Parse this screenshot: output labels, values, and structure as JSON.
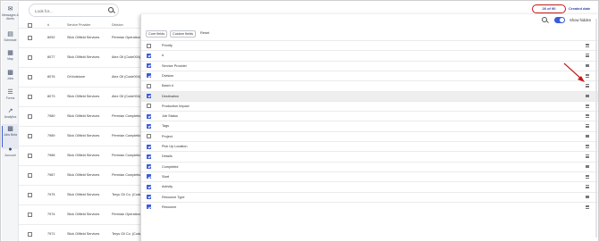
{
  "sidebar": {
    "items": [
      {
        "label": "Messages & Alerts",
        "icon": "chat-icon"
      },
      {
        "label": "Schedule",
        "icon": "calendar-icon"
      },
      {
        "label": "Map",
        "icon": "map-icon"
      },
      {
        "label": "Jobs",
        "icon": "jobs-icon"
      },
      {
        "label": "Forms",
        "icon": "forms-icon"
      },
      {
        "label": "Analytics",
        "icon": "analytics-icon"
      },
      {
        "label": "Jobs Beta",
        "icon": "jobs-beta-icon"
      },
      {
        "label": "Account",
        "icon": "account-icon"
      }
    ]
  },
  "search": {
    "placeholder": "Look for..."
  },
  "header": {
    "count_label": "26 of 90",
    "created_label": "Created date"
  },
  "table": {
    "columns": [
      "#",
      "Service Provider",
      "Division"
    ],
    "rows": [
      {
        "num": "8092",
        "provider": "Slick Oilfield Services",
        "division": "Permian Operations"
      },
      {
        "num": "8077",
        "provider": "Slick Oilfield Services",
        "division": "Alex Oil (Code004)"
      },
      {
        "num": "8076",
        "provider": "GrVodstone",
        "division": "Alex Oil (Code004)"
      },
      {
        "num": "8073",
        "provider": "Slick Oilfield Services",
        "division": "Alex Oil (Code004)"
      },
      {
        "num": "7980",
        "provider": "Slick Oilfield Services",
        "division": "Permian Completions"
      },
      {
        "num": "7989",
        "provider": "Slick Oilfield Services",
        "division": "Permian Completions"
      },
      {
        "num": "7988",
        "provider": "Slick Oilfield Services",
        "division": "Permian Completions"
      },
      {
        "num": "7987",
        "provider": "Slick Oilfield Services",
        "division": "Permian Completions"
      },
      {
        "num": "7975",
        "provider": "Slick Oilfield Services",
        "division": "Terys Oil Co. (Code001)"
      },
      {
        "num": "7974",
        "provider": "Slick Oilfield Services",
        "division": "Permian Operations"
      },
      {
        "num": "7972",
        "provider": "Slick Oilfield Services",
        "division": "Terys Oil Co. (Code001)"
      },
      {
        "num": "7971",
        "provider": "Slick Oilfield Services",
        "division": "Terys Oil Co. (Code001)"
      }
    ]
  },
  "panel": {
    "show_hidden_label": "Show hidden",
    "show_hidden_on": true,
    "tabs": [
      "Core fields",
      "Custom fields",
      "Reset"
    ],
    "fields": [
      {
        "label": "Priority",
        "checked": false
      },
      {
        "label": "#",
        "checked": true
      },
      {
        "label": "Service Provider",
        "checked": true
      },
      {
        "label": "Division",
        "checked": true
      },
      {
        "label": "Batch #",
        "checked": false
      },
      {
        "label": "Destination",
        "checked": true
      },
      {
        "label": "Production Impact",
        "checked": false
      },
      {
        "label": "Job Status",
        "checked": true
      },
      {
        "label": "Tags",
        "checked": true
      },
      {
        "label": "Project",
        "checked": false
      },
      {
        "label": "Pick Up Location",
        "checked": true
      },
      {
        "label": "Details",
        "checked": true
      },
      {
        "label": "Completed",
        "checked": true
      },
      {
        "label": "Start",
        "checked": true
      },
      {
        "label": "Activity",
        "checked": true
      },
      {
        "label": "Resource Type",
        "checked": true
      },
      {
        "label": "Resource",
        "checked": true
      }
    ]
  },
  "colors": {
    "accent": "#3b5bdb",
    "highlight": "#c41a1a"
  }
}
